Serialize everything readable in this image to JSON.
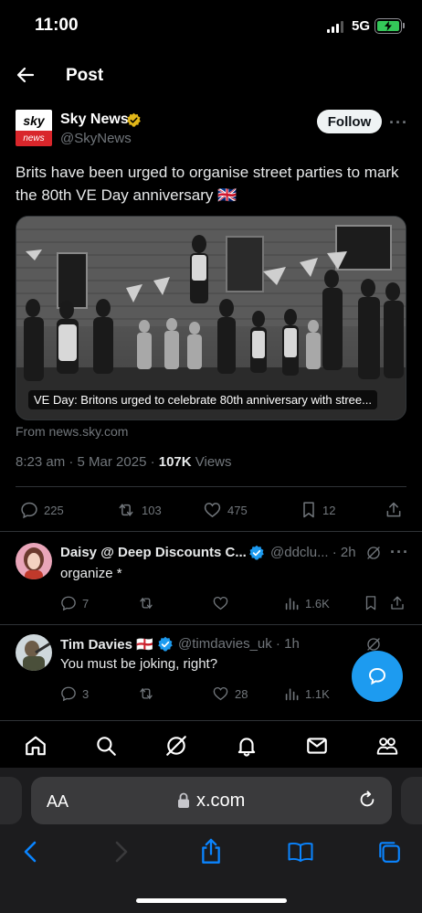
{
  "status_bar": {
    "time": "11:00",
    "network": "5G"
  },
  "header": {
    "title": "Post"
  },
  "post": {
    "author_name": "Sky News",
    "author_handle": "@SkyNews",
    "logo_top": "sky",
    "logo_bottom": "news",
    "follow_label": "Follow",
    "more": "···",
    "text": "Brits have been urged to organise street parties to mark the 80th VE Day anniversary 🇬🇧",
    "card_caption": "VE Day: Britons urged to celebrate 80th anniversary with stree...",
    "card_source": "From news.sky.com",
    "time": "8:23 am · 5 Mar 2025 · ",
    "views_count": "107K",
    "views_label": " Views",
    "stats": {
      "replies": "225",
      "reposts": "103",
      "likes": "475",
      "bookmarks": "12"
    }
  },
  "replies": [
    {
      "name": "Daisy @ Deep Discounts C...",
      "handle": "@ddclu... · 2h",
      "text": "organize *",
      "stats": {
        "replies": "7",
        "reposts": "",
        "likes": "",
        "views": "1.6K"
      }
    },
    {
      "name": "Tim Davies 🏴󠁧󠁢󠁥󠁮󠁧󠁿",
      "handle": "@timdavies_uk · 1h",
      "text": "You must be joking, right?",
      "stats": {
        "replies": "3",
        "reposts": "",
        "likes": "28",
        "views": "1.1K"
      }
    }
  ],
  "safari": {
    "aa_label": "AA",
    "url": "x.com"
  },
  "colors": {
    "accent": "#1d9bf0",
    "gold": "#e2b719",
    "sky_red": "#d9262b"
  }
}
